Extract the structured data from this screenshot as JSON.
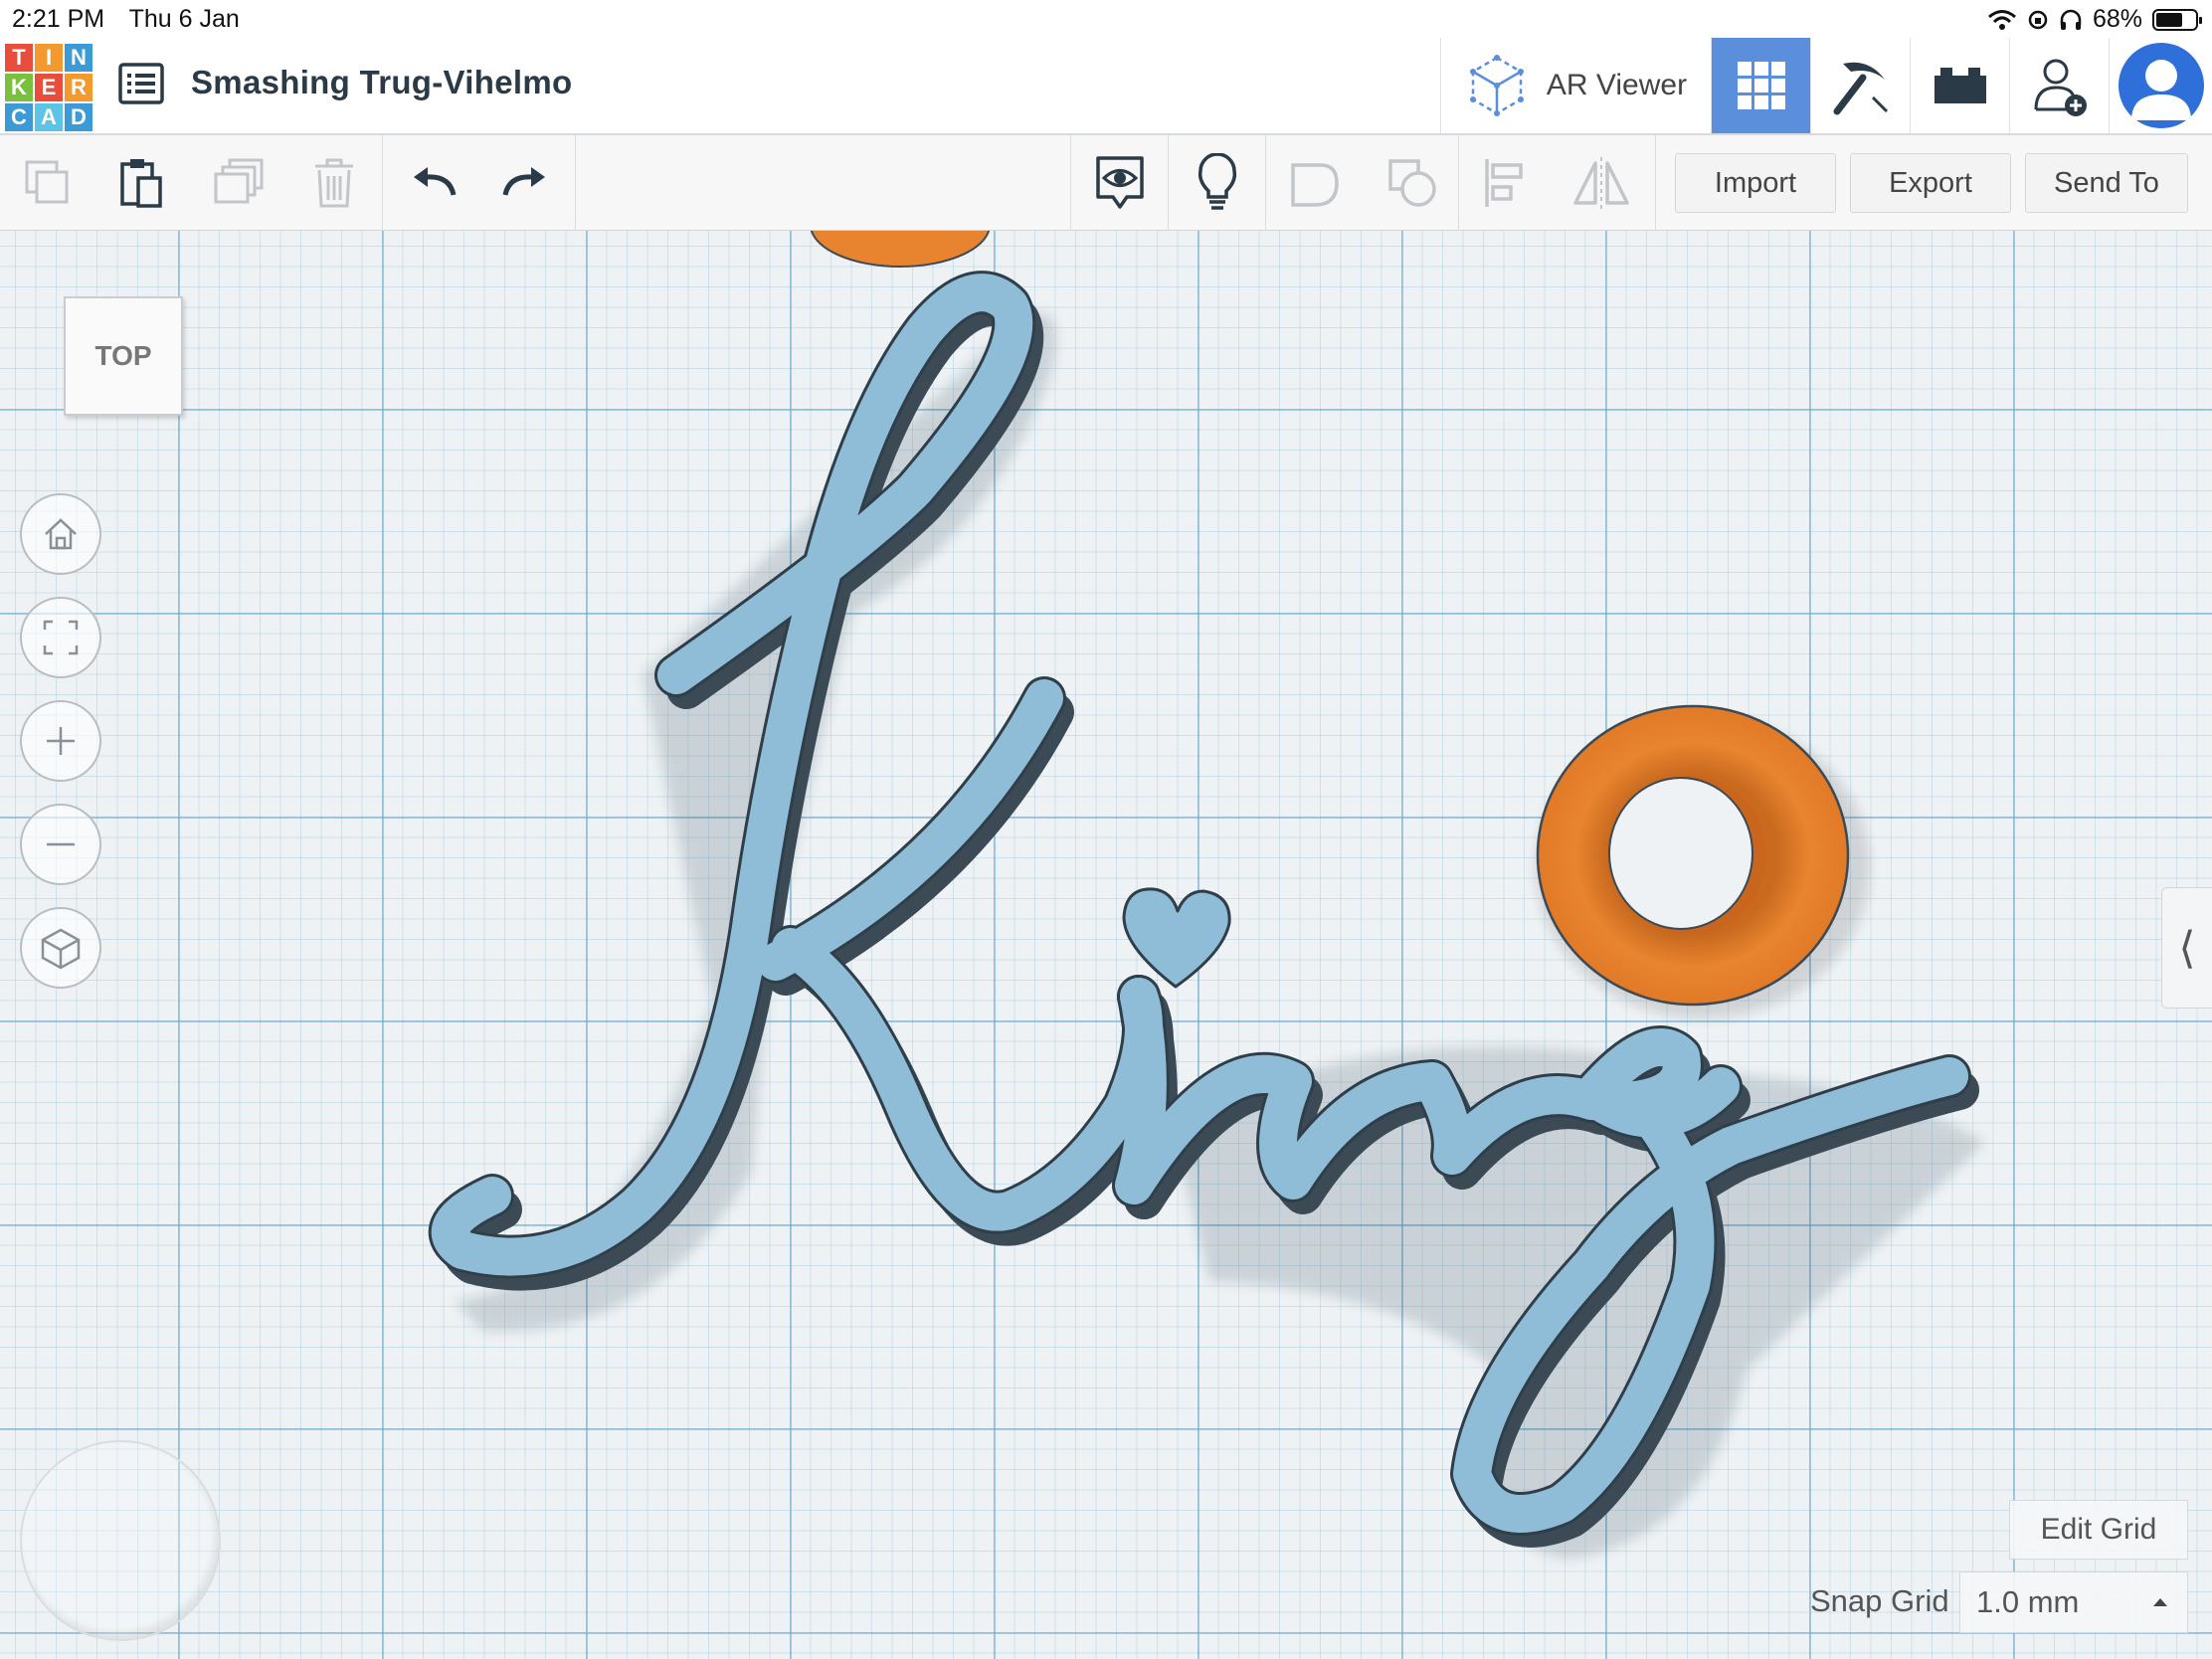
{
  "status_bar": {
    "time": "2:21 PM",
    "date": "Thu 6 Jan",
    "battery": "68%",
    "battery_level": 0.68
  },
  "header": {
    "logo_letters": [
      "T",
      "I",
      "N",
      "K",
      "E",
      "R",
      "C",
      "A",
      "D"
    ],
    "project_title": "Smashing Trug-Vihelmo",
    "ar_viewer_label": "AR Viewer"
  },
  "toolbar": {
    "import_label": "Import",
    "export_label": "Export",
    "send_to_label": "Send To"
  },
  "workplane": {
    "view_cube_label": "TOP",
    "edit_grid_label": "Edit Grid",
    "snap_grid_label": "Snap Grid",
    "snap_grid_value": "1.0 mm",
    "side_panel_toggle": "⟨"
  },
  "colors": {
    "accent_blue": "#5b8edb",
    "shape_blue": "#8fbdd8",
    "shape_orange": "#e8842f"
  }
}
